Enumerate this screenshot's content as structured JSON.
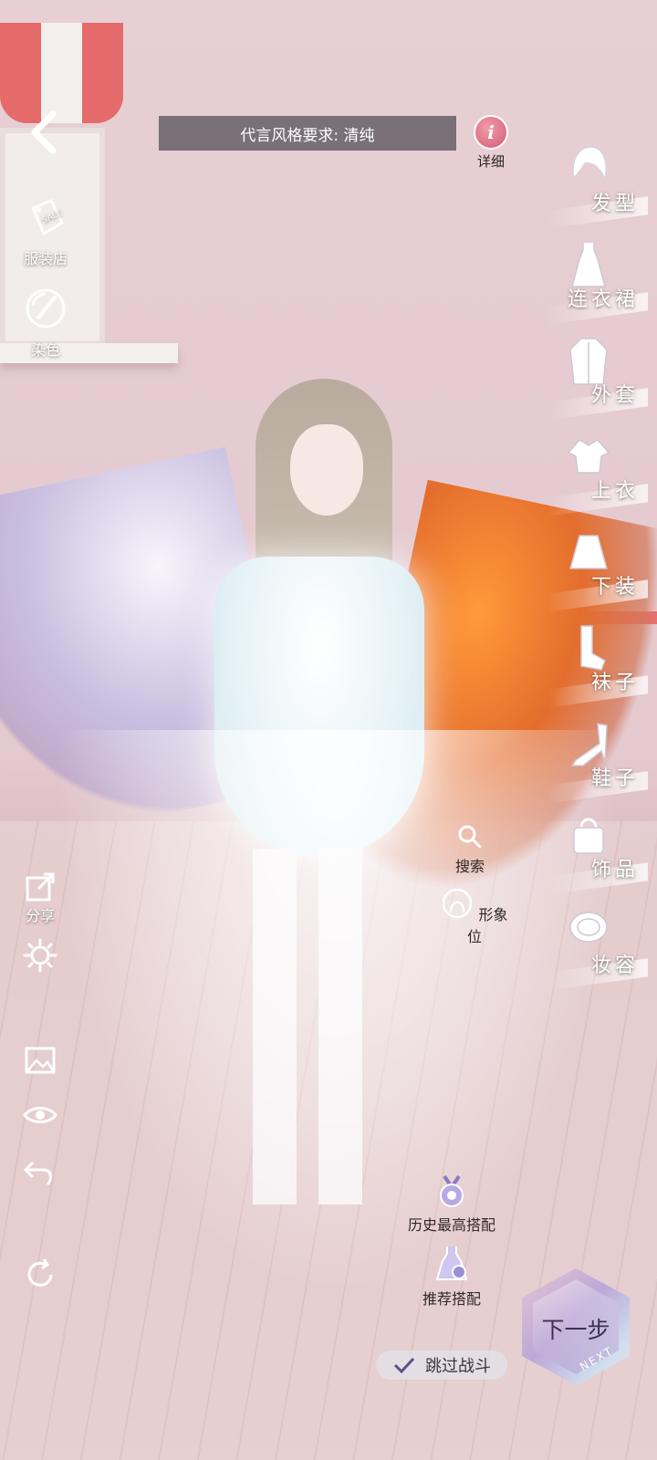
{
  "header": {
    "back_icon": "chevron-left-icon",
    "style_requirement": "代言风格要求: 清纯",
    "detail_label": "详细",
    "detail_icon_glyph": "i"
  },
  "left_tools": [
    {
      "label": "服装店",
      "icon": "sale-tag-icon"
    },
    {
      "label": "染色",
      "icon": "dye-palette-icon"
    }
  ],
  "categories": [
    {
      "label": "发型",
      "icon": "hair-icon"
    },
    {
      "label": "连衣裙",
      "icon": "dress-icon"
    },
    {
      "label": "外套",
      "icon": "coat-icon"
    },
    {
      "label": "上衣",
      "icon": "top-icon"
    },
    {
      "label": "下装",
      "icon": "skirt-icon"
    },
    {
      "label": "袜子",
      "icon": "socks-icon"
    },
    {
      "label": "鞋子",
      "icon": "shoe-icon"
    },
    {
      "label": "饰品",
      "icon": "accessory-bag-icon"
    },
    {
      "label": "妆容",
      "icon": "makeup-icon"
    }
  ],
  "side_actions": {
    "share_label": "分享",
    "icons": [
      "share-icon",
      "settings-gear-icon",
      "photo-icon",
      "eye-icon",
      "undo-icon",
      "reset-icon"
    ]
  },
  "middle_tools": {
    "search_label": "搜索",
    "image_position_label": "形象位",
    "history_best_label": "历史最高搭配",
    "recommended_label": "推荐搭配"
  },
  "footer": {
    "next_label": "下一步",
    "next_sub": "NEXT",
    "skip_battle_label": "跳过战斗"
  },
  "colors": {
    "accent_pink": "#d25d75",
    "bar_bg": "#55505890"
  }
}
